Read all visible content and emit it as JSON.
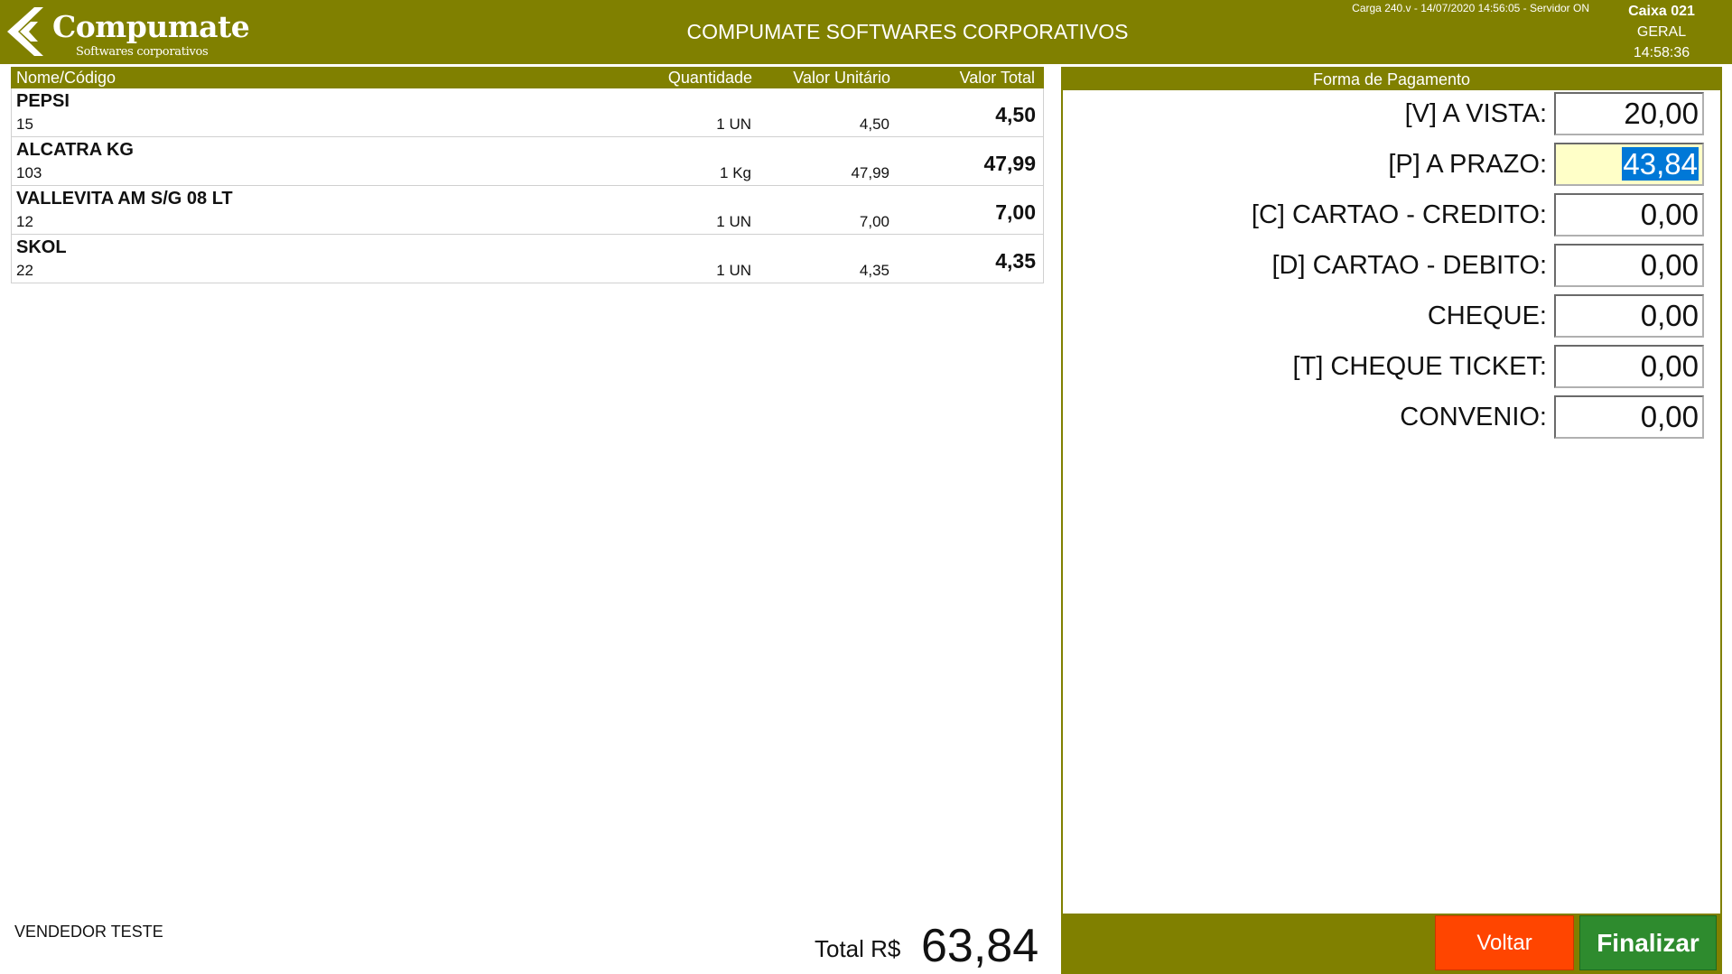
{
  "header": {
    "logo_name": "Compumate",
    "logo_sub": "Softwares corporativos",
    "title": "COMPUMATE SOFTWARES CORPORATIVOS",
    "status": "Carga 240.v - 14/07/2020 14:56:05 - Servidor ON",
    "caixa": "Caixa 021",
    "group": "GERAL",
    "time": "14:58:36"
  },
  "items_table": {
    "col_name": "Nome/Código",
    "col_qty": "Quantidade",
    "col_unit": "Valor Unitário",
    "col_total": "Valor Total",
    "rows": [
      {
        "name": "PEPSI",
        "code": "15",
        "qty": "1 UN",
        "unit": "4,50",
        "total": "4,50"
      },
      {
        "name": "ALCATRA KG",
        "code": "103",
        "qty": "1 Kg",
        "unit": "47,99",
        "total": "47,99"
      },
      {
        "name": "VALLEVITA AM S/G 08 LT",
        "code": "12",
        "qty": "1 UN",
        "unit": "7,00",
        "total": "7,00"
      },
      {
        "name": "SKOL",
        "code": "22",
        "qty": "1 UN",
        "unit": "4,35",
        "total": "4,35"
      }
    ]
  },
  "footer": {
    "vendedor": "VENDEDOR TESTE",
    "total_label": "Total R$",
    "total_value": "63,84"
  },
  "payment": {
    "title": "Forma de Pagamento",
    "methods": [
      {
        "label": "[V] A VISTA:",
        "value": "20,00"
      },
      {
        "label": "[P] A PRAZO:",
        "value": "43,84"
      },
      {
        "label": "[C] CARTAO - CREDITO:",
        "value": "0,00"
      },
      {
        "label": "[D] CARTAO - DEBITO:",
        "value": "0,00"
      },
      {
        "label": "CHEQUE:",
        "value": "0,00"
      },
      {
        "label": "[T] CHEQUE TICKET:",
        "value": "0,00"
      },
      {
        "label": "CONVENIO:",
        "value": "0,00"
      }
    ],
    "voltar_label": "Voltar",
    "finalizar_label": "Finalizar"
  },
  "colors": {
    "brand": "#808000",
    "voltar": "#ff4500",
    "finalizar": "#2e8b2e",
    "active_field": "#ffffc8",
    "selection": "#0078d7"
  }
}
